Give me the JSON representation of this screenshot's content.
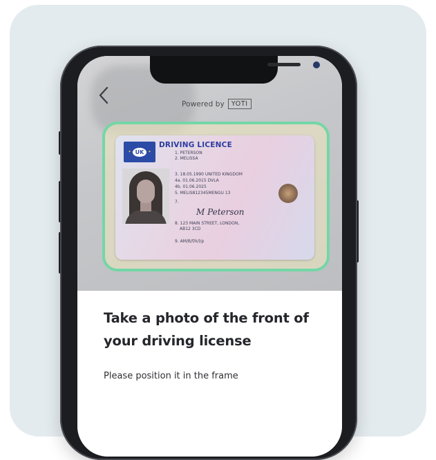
{
  "colors": {
    "panel_bg": "#e4ebee",
    "frame_border": "#74d6a6",
    "card_title": "#2c3ba0",
    "heading_text": "#25262b"
  },
  "header": {
    "back_icon": "chevron-left-icon",
    "powered_label": "Powered by",
    "brand_badge": "YOTI"
  },
  "licence": {
    "country_badge": "UK",
    "title": "DRIVING LICENCE",
    "surname": "1. PETERSON",
    "given_name": "2. MELISSA",
    "birth": "3. 18.05.1990 UNITED KINGDOM",
    "issue": "4a. 01.06.2015    DVLA",
    "expiry": "4b. 01.06.2025",
    "number": "5. MELIS812345MENGU 13",
    "line7": "7.",
    "signature": "M Peterson",
    "address": "8. 123 MAIN STREET, LONDON,",
    "postcode": "AB12 3CD",
    "categories": "9. AM/B/f/k/l/p"
  },
  "instructions": {
    "title": "Take a photo of the front of your driving license",
    "subtitle": "Please position it in the frame"
  }
}
